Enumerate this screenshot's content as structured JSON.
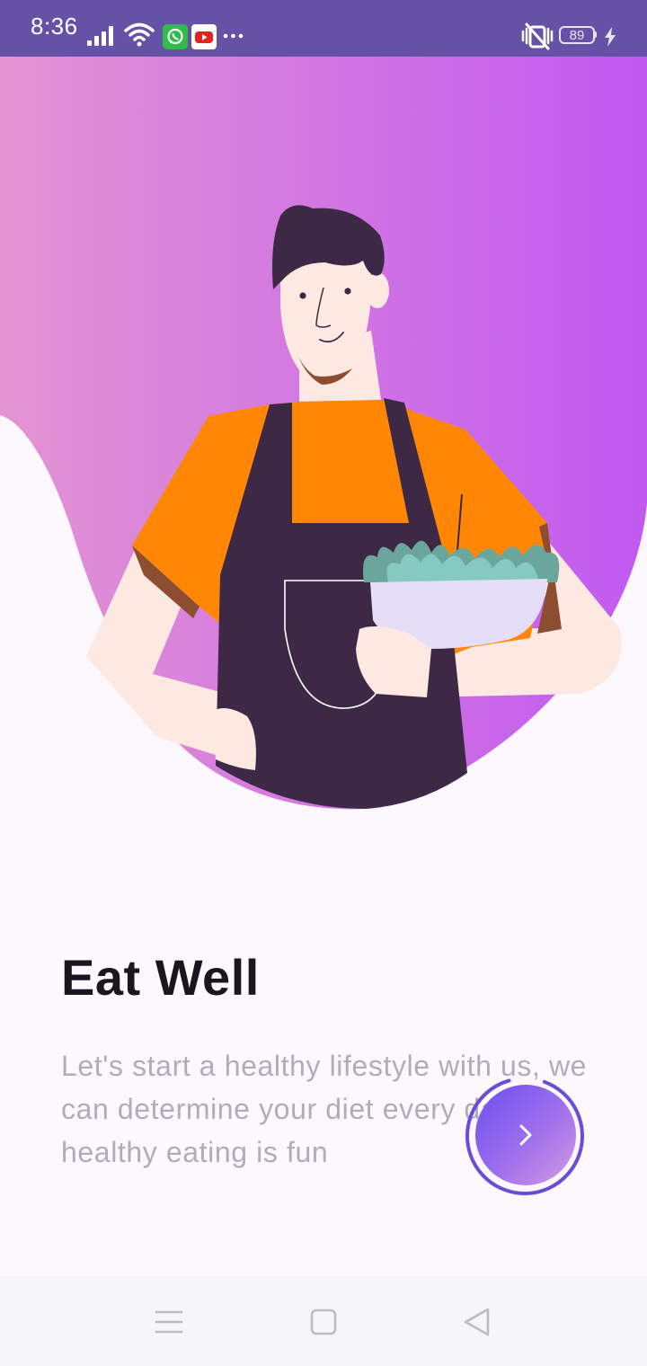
{
  "status_bar": {
    "time": "8:36",
    "battery_level": "89",
    "icons": [
      "signal-icon",
      "wifi-icon",
      "whatsapp-icon",
      "youtube-icon",
      "more-notifications-icon",
      "vibrate-off-icon",
      "battery-icon",
      "charging-icon"
    ],
    "colors": {
      "background": "#6552a6",
      "whatsapp": "#2fbd47",
      "youtube": "#e1251b"
    }
  },
  "onboarding": {
    "title": "Eat Well",
    "description": "Let's start a healthy lifestyle with us, we can determine your diet every day. healthy eating is fun",
    "illustration": "chef-holding-salad-bowl",
    "gradient_colors": [
      "#e394d2",
      "#c159f1"
    ],
    "progress": 0.9
  },
  "next_button": {
    "icon": "chevron-right-icon"
  },
  "nav_bar": {
    "buttons": [
      "menu-icon",
      "home-square-icon",
      "back-triangle-icon"
    ]
  }
}
